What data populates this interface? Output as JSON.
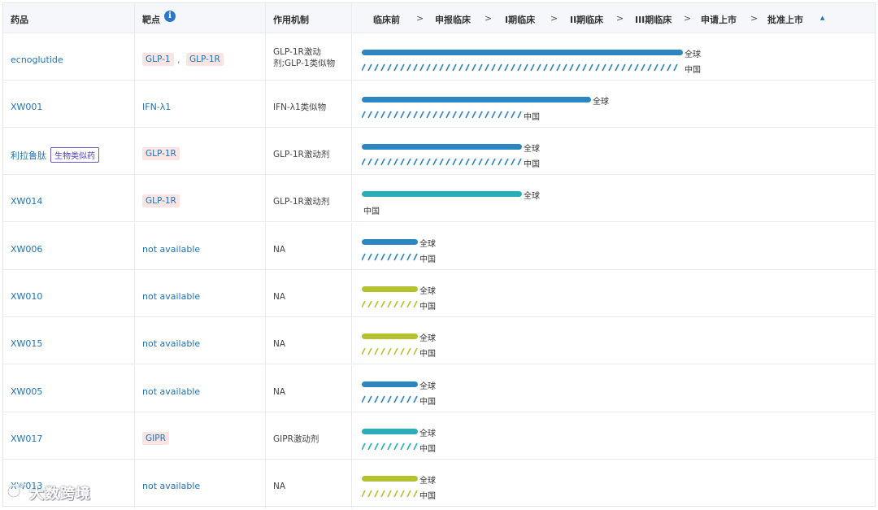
{
  "header": {
    "drug": "药品",
    "target": "靶点",
    "info_icon": "i",
    "mechanism": "作用机制",
    "phases": [
      "临床前",
      "申报临床",
      "I期临床",
      "II期临床",
      "III期临床",
      "申请上市",
      "批准上市"
    ],
    "separator": ">",
    "sort_icon": "▲"
  },
  "colors": {
    "blue": "#2b86c2",
    "teal": "#2aafb8",
    "olive": "#b5c230",
    "link": "#1f73b7",
    "target_bg": "#fbe4e2"
  },
  "bar_scale_note": "fractions of the 7-phase track",
  "rows": [
    {
      "drug": "ecnoglutide",
      "bio_tag": "",
      "targets": [
        "GLP-1",
        "GLP-1R"
      ],
      "target_sep": ",",
      "target_style": "tag",
      "mechanism": "GLP-1R激动剂;GLP-1类似物",
      "color": "blue",
      "global_progress": 0.98,
      "china_progress": 0.98,
      "china_hatched": true,
      "global_label": "全球",
      "china_label": "中国"
    },
    {
      "drug": "XW001",
      "bio_tag": "",
      "targets": [
        "IFN-λ1"
      ],
      "target_style": "text",
      "mechanism": "IFN-λ1类似物",
      "color": "blue",
      "global_progress": 0.7,
      "china_progress": 0.49,
      "china_hatched": true,
      "global_label": "全球",
      "china_label": "中国"
    },
    {
      "drug": "利拉鲁肽",
      "bio_tag": "生物类似药",
      "targets": [
        "GLP-1R"
      ],
      "target_style": "tag",
      "mechanism": "GLP-1R激动剂",
      "color": "blue",
      "global_progress": 0.49,
      "china_progress": 0.49,
      "china_hatched": true,
      "global_label": "全球",
      "china_label": "中国"
    },
    {
      "drug": "XW014",
      "bio_tag": "",
      "targets": [
        "GLP-1R"
      ],
      "target_style": "tag",
      "mechanism": "GLP-1R激动剂",
      "color": "teal",
      "global_progress": 0.49,
      "china_progress": 0,
      "china_hatched": false,
      "global_label": "全球",
      "china_label": "中国"
    },
    {
      "drug": "XW006",
      "bio_tag": "",
      "targets": [
        "not available"
      ],
      "target_style": "text",
      "mechanism": "NA",
      "color": "blue",
      "global_progress": 0.17,
      "china_progress": 0.17,
      "china_hatched": true,
      "global_label": "全球",
      "china_label": "中国"
    },
    {
      "drug": "XW010",
      "bio_tag": "",
      "targets": [
        "not available"
      ],
      "target_style": "text",
      "mechanism": "NA",
      "color": "olive",
      "global_progress": 0.17,
      "china_progress": 0.17,
      "china_hatched": true,
      "global_label": "全球",
      "china_label": "中国"
    },
    {
      "drug": "XW015",
      "bio_tag": "",
      "targets": [
        "not available"
      ],
      "target_style": "text",
      "mechanism": "NA",
      "color": "olive",
      "global_progress": 0.17,
      "china_progress": 0.17,
      "china_hatched": true,
      "global_label": "全球",
      "china_label": "中国"
    },
    {
      "drug": "XW005",
      "bio_tag": "",
      "targets": [
        "not available"
      ],
      "target_style": "text",
      "mechanism": "NA",
      "color": "blue",
      "global_progress": 0.17,
      "china_progress": 0.17,
      "china_hatched": true,
      "global_label": "全球",
      "china_label": "中国"
    },
    {
      "drug": "XW017",
      "bio_tag": "",
      "targets": [
        "GIPR"
      ],
      "target_style": "tag",
      "mechanism": "GIPR激动剂",
      "color": "teal",
      "global_progress": 0.17,
      "china_progress": 0.17,
      "china_hatched": true,
      "global_label": "全球",
      "china_label": "中国"
    },
    {
      "drug": "XW013",
      "bio_tag": "",
      "targets": [
        "not available"
      ],
      "target_style": "text",
      "mechanism": "NA",
      "color": "olive",
      "global_progress": 0.17,
      "china_progress": 0.17,
      "china_hatched": true,
      "global_label": "全球",
      "china_label": "中国"
    }
  ],
  "watermark": "大数跨境"
}
